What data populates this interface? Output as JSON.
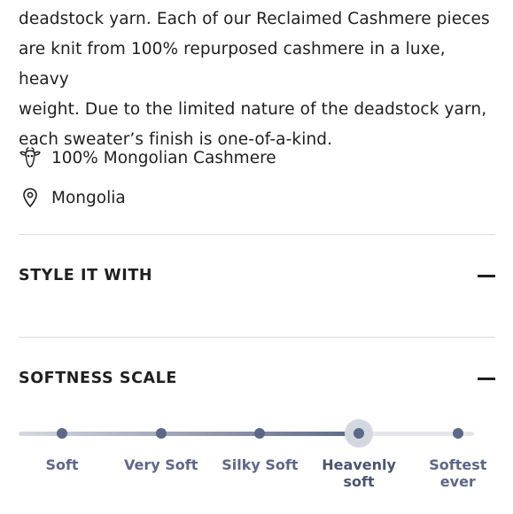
{
  "description": {
    "lines": [
      "deadstock yarn. Each of our Reclaimed Cashmere pieces",
      "are knit from 100% repurposed cashmere in a luxe, heavy",
      "weight. Due to the limited nature of the deadstock yarn,",
      "each sweater’s finish is one-of-a-kind."
    ]
  },
  "attributes": [
    {
      "icon": "goat-icon",
      "label": "100% Mongolian Cashmere"
    },
    {
      "icon": "location-pin-icon",
      "label": "Mongolia"
    }
  ],
  "sections": {
    "style_it_with": {
      "title": "STYLE IT WITH",
      "toggle": "collapse"
    },
    "softness_scale": {
      "title": "SOFTNESS SCALE",
      "toggle": "collapse"
    }
  },
  "softness_scale": {
    "levels": [
      "Soft",
      "Very Soft",
      "Silky Soft",
      "Heavenly soft",
      "Softest ever"
    ],
    "selected_index": 3,
    "colors": {
      "active": "#5c6887",
      "track": "#e4e6ea",
      "halo": "#d3d7df"
    }
  }
}
